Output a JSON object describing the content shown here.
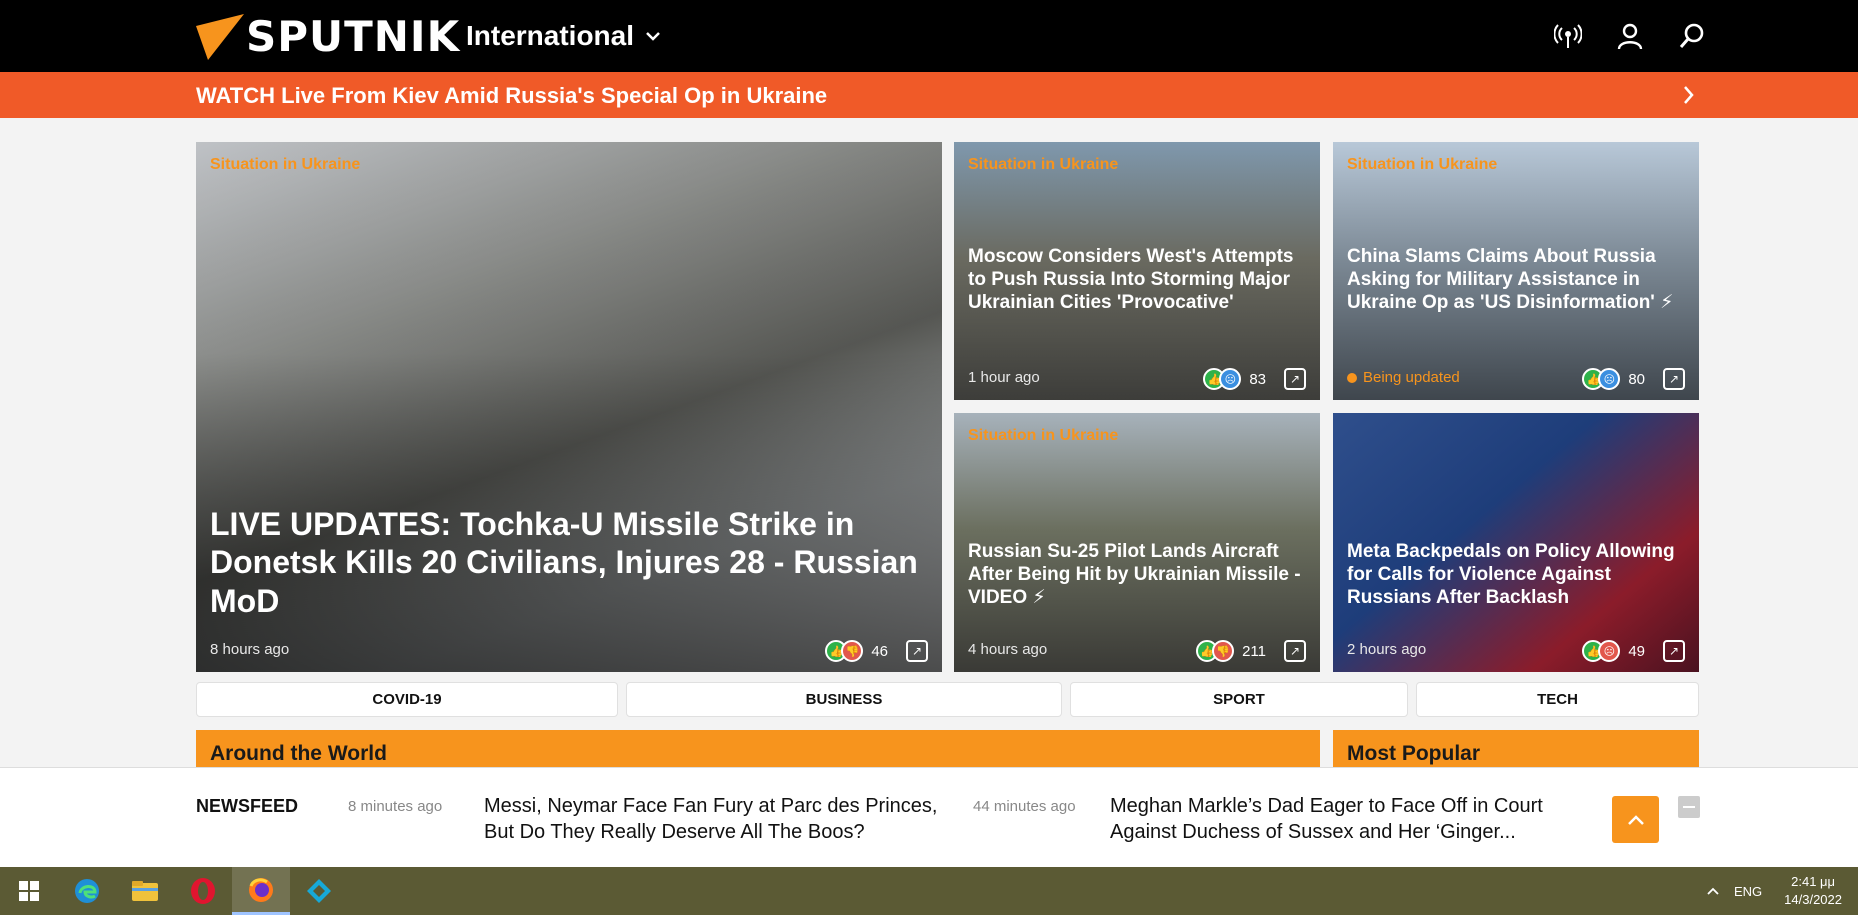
{
  "header": {
    "brand": "SPUTNIK",
    "edition": "International",
    "icons": [
      "broadcast-icon",
      "user-icon",
      "search-icon"
    ]
  },
  "banner": {
    "text": "WATCH Live From Kiev Amid Russia's Special Op in Ukraine"
  },
  "cards": [
    {
      "category": "Situation in Ukraine",
      "title": "LIVE UPDATES: Tochka-U Missile Strike in Donetsk Kills 20 Civilians, Injures 28 - Russian MoD",
      "time": "8 hours ago",
      "count": "46"
    },
    {
      "category": "Situation in Ukraine",
      "title": "Moscow Considers West's Attempts to Push Russia Into Storming Major Ukrainian Cities 'Provocative'",
      "time": "1 hour ago",
      "count": "83"
    },
    {
      "category": "Situation in Ukraine",
      "title": "China Slams Claims About Russia Asking for Military Assistance in Ukraine Op as 'US Disinformation' ⚡",
      "status": "Being updated",
      "count": "80"
    },
    {
      "category": "Situation in Ukraine",
      "title": "Russian Su-25 Pilot Lands Aircraft After Being Hit by Ukrainian Missile - VIDEO ⚡",
      "time": "4 hours ago",
      "count": "211"
    },
    {
      "category": "",
      "title": "Meta Backpedals on Policy Allowing for Calls for Violence Against Russians After Backlash",
      "time": "2 hours ago",
      "count": "49"
    }
  ],
  "tabs": [
    "COVID-19",
    "BUSINESS",
    "SPORT",
    "TECH"
  ],
  "sections": {
    "around": "Around the World",
    "popular": "Most Popular"
  },
  "newsfeed": {
    "label": "NEWSFEED",
    "items": [
      {
        "time": "8 minutes ago",
        "headline": "Messi, Neymar Face Fan Fury at Parc des Princes, But Do They Really Deserve All The Boos?"
      },
      {
        "time": "44 minutes ago",
        "headline": "Meghan Markle’s Dad Eager to Face Off in Court Against Duchess of Sussex and Her ‘Ginger..."
      }
    ]
  },
  "taskbar": {
    "apps": [
      "windows-start-icon",
      "edge-icon",
      "file-explorer-icon",
      "opera-icon",
      "firefox-icon",
      "kodi-icon"
    ],
    "lang": "ENG",
    "time": "2:41 μμ",
    "date": "14/3/2022"
  },
  "colors": {
    "accent": "#f7941d",
    "banner": "#f05a28",
    "header": "#000000"
  }
}
